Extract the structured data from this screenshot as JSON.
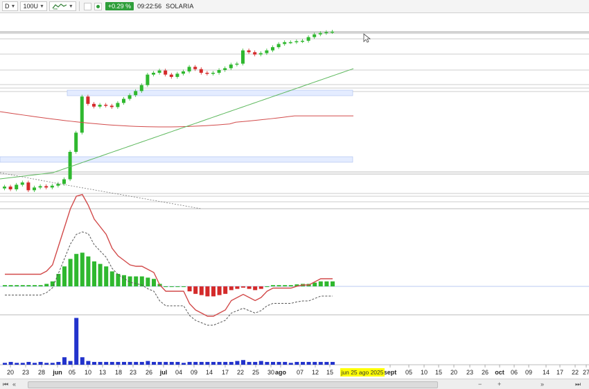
{
  "toolbar": {
    "period_label": "D",
    "bars_label": "100U",
    "indicator_icon": "indicator-wave-icon",
    "change_value": "+0.29 %",
    "time": "09:22:56",
    "ticker": "SOLARIA"
  },
  "axis": {
    "date_ticks": [
      "20",
      "23",
      "28",
      "jun",
      "05",
      "10",
      "13",
      "18",
      "23",
      "26",
      "jul",
      "04",
      "09",
      "14",
      "17",
      "22",
      "25",
      "30",
      "ago",
      "07",
      "12",
      "15",
      "sept",
      "05",
      "10",
      "15",
      "20",
      "23",
      "26",
      "oct",
      "06",
      "09",
      "14",
      "17",
      "22",
      "27"
    ],
    "cursor_date": "jun 25 ago 2025"
  },
  "chart_data": {
    "type": "candlestick",
    "panels": [
      "price",
      "momentum",
      "volume"
    ],
    "price_closes": [
      8.72,
      8.66,
      8.76,
      8.81,
      8.64,
      8.7,
      8.73,
      8.7,
      8.74,
      8.78,
      8.88,
      9.48,
      9.9,
      10.69,
      10.53,
      10.47,
      10.51,
      10.49,
      10.46,
      10.55,
      10.64,
      10.72,
      10.81,
      10.94,
      11.17,
      11.21,
      11.26,
      11.17,
      11.12,
      11.19,
      11.24,
      11.34,
      11.29,
      11.21,
      11.19,
      11.21,
      11.27,
      11.31,
      11.39,
      11.41,
      11.7,
      11.66,
      11.61,
      11.64,
      11.7,
      11.77,
      11.84,
      11.88,
      11.88,
      11.9,
      11.91,
      11.99,
      12.05,
      12.08,
      12.1,
      12.11
    ],
    "moving_average_red": "flat-declining",
    "moving_average_green": "rising",
    "momentum_values": [
      0.05,
      0.05,
      0.05,
      0.05,
      0.05,
      0.05,
      0.05,
      0.1,
      0.2,
      0.5,
      0.8,
      1.1,
      1.3,
      1.35,
      1.2,
      1.0,
      0.9,
      0.8,
      0.6,
      0.5,
      0.45,
      0.4,
      0.4,
      0.4,
      0.35,
      0.3,
      0.1,
      0,
      0,
      0,
      0,
      -0.2,
      -0.3,
      -0.35,
      -0.4,
      -0.4,
      -0.35,
      -0.3,
      -0.15,
      -0.1,
      -0.05,
      -0.1,
      -0.15,
      -0.1,
      0,
      0.05,
      0.05,
      0.05,
      0.05,
      0.08,
      0.1,
      0.1,
      0.15,
      0.2,
      0.2,
      0.2
    ],
    "volume_values": [
      2,
      3,
      2,
      2,
      3,
      2,
      3,
      2,
      2,
      3,
      8,
      4,
      50,
      8,
      4,
      3,
      3,
      3,
      3,
      3,
      3,
      3,
      3,
      3,
      4,
      3,
      3,
      3,
      3,
      3,
      2,
      3,
      3,
      3,
      3,
      3,
      3,
      3,
      3,
      4,
      5,
      3,
      3,
      4,
      3,
      3,
      3,
      3,
      2,
      3,
      3,
      3,
      3,
      3,
      3,
      3
    ]
  },
  "colors": {
    "up": "#2fb82f",
    "down": "#d42a2a",
    "ma_red": "#d24a4a",
    "ma_green": "#5cb85c",
    "volume": "#2233cc",
    "highlight": "#ffff00"
  }
}
